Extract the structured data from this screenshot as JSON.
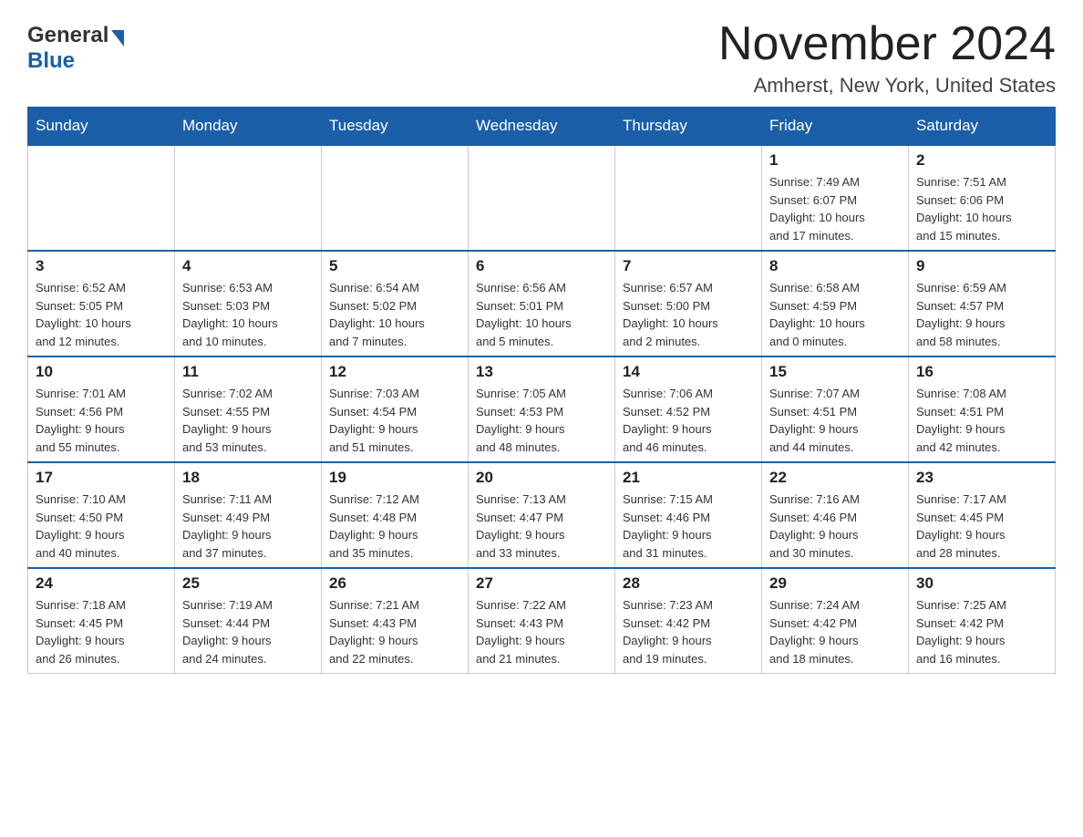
{
  "header": {
    "logo_general": "General",
    "logo_blue": "Blue",
    "month_title": "November 2024",
    "location": "Amherst, New York, United States"
  },
  "weekdays": [
    "Sunday",
    "Monday",
    "Tuesday",
    "Wednesday",
    "Thursday",
    "Friday",
    "Saturday"
  ],
  "weeks": [
    [
      {
        "day": "",
        "info": ""
      },
      {
        "day": "",
        "info": ""
      },
      {
        "day": "",
        "info": ""
      },
      {
        "day": "",
        "info": ""
      },
      {
        "day": "",
        "info": ""
      },
      {
        "day": "1",
        "info": "Sunrise: 7:49 AM\nSunset: 6:07 PM\nDaylight: 10 hours\nand 17 minutes."
      },
      {
        "day": "2",
        "info": "Sunrise: 7:51 AM\nSunset: 6:06 PM\nDaylight: 10 hours\nand 15 minutes."
      }
    ],
    [
      {
        "day": "3",
        "info": "Sunrise: 6:52 AM\nSunset: 5:05 PM\nDaylight: 10 hours\nand 12 minutes."
      },
      {
        "day": "4",
        "info": "Sunrise: 6:53 AM\nSunset: 5:03 PM\nDaylight: 10 hours\nand 10 minutes."
      },
      {
        "day": "5",
        "info": "Sunrise: 6:54 AM\nSunset: 5:02 PM\nDaylight: 10 hours\nand 7 minutes."
      },
      {
        "day": "6",
        "info": "Sunrise: 6:56 AM\nSunset: 5:01 PM\nDaylight: 10 hours\nand 5 minutes."
      },
      {
        "day": "7",
        "info": "Sunrise: 6:57 AM\nSunset: 5:00 PM\nDaylight: 10 hours\nand 2 minutes."
      },
      {
        "day": "8",
        "info": "Sunrise: 6:58 AM\nSunset: 4:59 PM\nDaylight: 10 hours\nand 0 minutes."
      },
      {
        "day": "9",
        "info": "Sunrise: 6:59 AM\nSunset: 4:57 PM\nDaylight: 9 hours\nand 58 minutes."
      }
    ],
    [
      {
        "day": "10",
        "info": "Sunrise: 7:01 AM\nSunset: 4:56 PM\nDaylight: 9 hours\nand 55 minutes."
      },
      {
        "day": "11",
        "info": "Sunrise: 7:02 AM\nSunset: 4:55 PM\nDaylight: 9 hours\nand 53 minutes."
      },
      {
        "day": "12",
        "info": "Sunrise: 7:03 AM\nSunset: 4:54 PM\nDaylight: 9 hours\nand 51 minutes."
      },
      {
        "day": "13",
        "info": "Sunrise: 7:05 AM\nSunset: 4:53 PM\nDaylight: 9 hours\nand 48 minutes."
      },
      {
        "day": "14",
        "info": "Sunrise: 7:06 AM\nSunset: 4:52 PM\nDaylight: 9 hours\nand 46 minutes."
      },
      {
        "day": "15",
        "info": "Sunrise: 7:07 AM\nSunset: 4:51 PM\nDaylight: 9 hours\nand 44 minutes."
      },
      {
        "day": "16",
        "info": "Sunrise: 7:08 AM\nSunset: 4:51 PM\nDaylight: 9 hours\nand 42 minutes."
      }
    ],
    [
      {
        "day": "17",
        "info": "Sunrise: 7:10 AM\nSunset: 4:50 PM\nDaylight: 9 hours\nand 40 minutes."
      },
      {
        "day": "18",
        "info": "Sunrise: 7:11 AM\nSunset: 4:49 PM\nDaylight: 9 hours\nand 37 minutes."
      },
      {
        "day": "19",
        "info": "Sunrise: 7:12 AM\nSunset: 4:48 PM\nDaylight: 9 hours\nand 35 minutes."
      },
      {
        "day": "20",
        "info": "Sunrise: 7:13 AM\nSunset: 4:47 PM\nDaylight: 9 hours\nand 33 minutes."
      },
      {
        "day": "21",
        "info": "Sunrise: 7:15 AM\nSunset: 4:46 PM\nDaylight: 9 hours\nand 31 minutes."
      },
      {
        "day": "22",
        "info": "Sunrise: 7:16 AM\nSunset: 4:46 PM\nDaylight: 9 hours\nand 30 minutes."
      },
      {
        "day": "23",
        "info": "Sunrise: 7:17 AM\nSunset: 4:45 PM\nDaylight: 9 hours\nand 28 minutes."
      }
    ],
    [
      {
        "day": "24",
        "info": "Sunrise: 7:18 AM\nSunset: 4:45 PM\nDaylight: 9 hours\nand 26 minutes."
      },
      {
        "day": "25",
        "info": "Sunrise: 7:19 AM\nSunset: 4:44 PM\nDaylight: 9 hours\nand 24 minutes."
      },
      {
        "day": "26",
        "info": "Sunrise: 7:21 AM\nSunset: 4:43 PM\nDaylight: 9 hours\nand 22 minutes."
      },
      {
        "day": "27",
        "info": "Sunrise: 7:22 AM\nSunset: 4:43 PM\nDaylight: 9 hours\nand 21 minutes."
      },
      {
        "day": "28",
        "info": "Sunrise: 7:23 AM\nSunset: 4:42 PM\nDaylight: 9 hours\nand 19 minutes."
      },
      {
        "day": "29",
        "info": "Sunrise: 7:24 AM\nSunset: 4:42 PM\nDaylight: 9 hours\nand 18 minutes."
      },
      {
        "day": "30",
        "info": "Sunrise: 7:25 AM\nSunset: 4:42 PM\nDaylight: 9 hours\nand 16 minutes."
      }
    ]
  ]
}
